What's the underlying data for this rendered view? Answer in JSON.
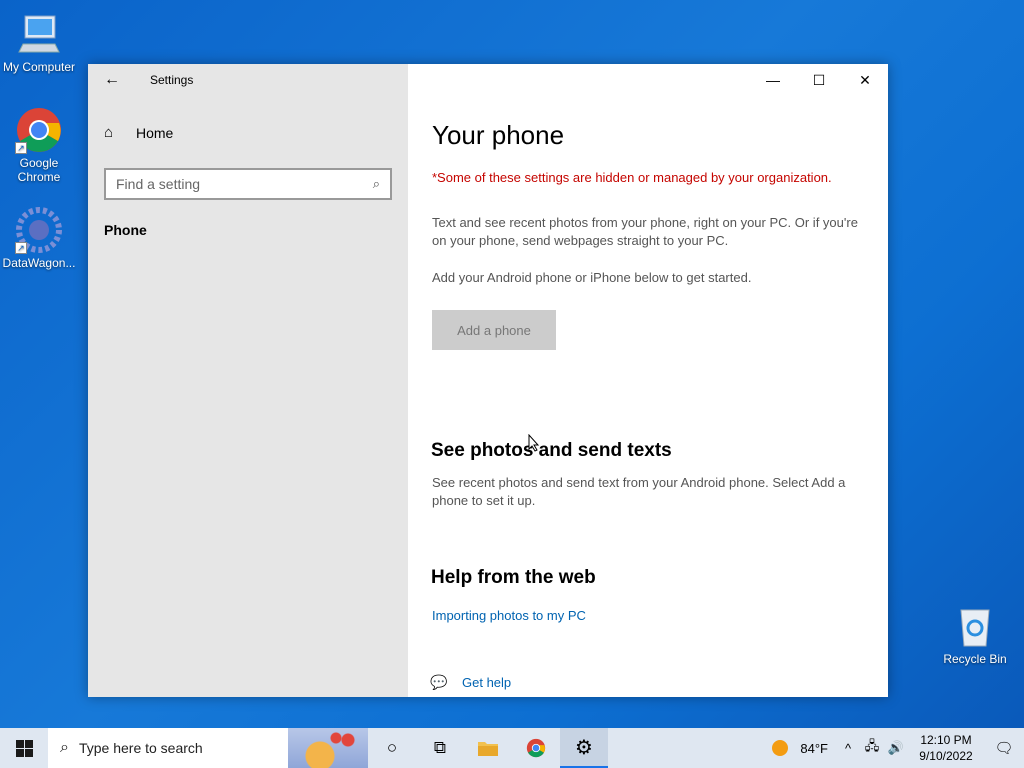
{
  "desktop": {
    "icons": [
      {
        "label": "My Computer"
      },
      {
        "label": "Google Chrome"
      },
      {
        "label": "DataWagon..."
      },
      {
        "label": "Recycle Bin"
      }
    ]
  },
  "window": {
    "app_title": "Settings",
    "sidebar": {
      "home_label": "Home",
      "search_placeholder": "Find a setting",
      "nav_items": [
        {
          "label": "Phone",
          "selected": true
        }
      ]
    },
    "content": {
      "title": "Your phone",
      "warning": "*Some of these settings are hidden or managed by your organization.",
      "intro": "Text and see recent photos from your phone, right on your PC. Or if you're on your phone, send webpages straight to your PC.",
      "add_prompt": "Add your Android phone or iPhone below to get started.",
      "add_button": "Add a phone",
      "section1_title": "See photos and send texts",
      "section1_text": "See recent photos and send text from your Android phone. Select Add a phone to set it up.",
      "section2_title": "Help from the web",
      "web_link": "Importing photos to my PC",
      "get_help": "Get help"
    },
    "colors": {
      "warning": "#c50500",
      "link": "#0063b1",
      "sidebar_bg": "#e6e6e6"
    }
  },
  "taskbar": {
    "search_placeholder": "Type here to search",
    "pinned": [
      "cortana-icon",
      "task-view-icon",
      "file-explorer-icon",
      "chrome-icon",
      "settings-icon"
    ],
    "weather": "84°F",
    "time": "12:10 PM",
    "date": "9/10/2022"
  }
}
